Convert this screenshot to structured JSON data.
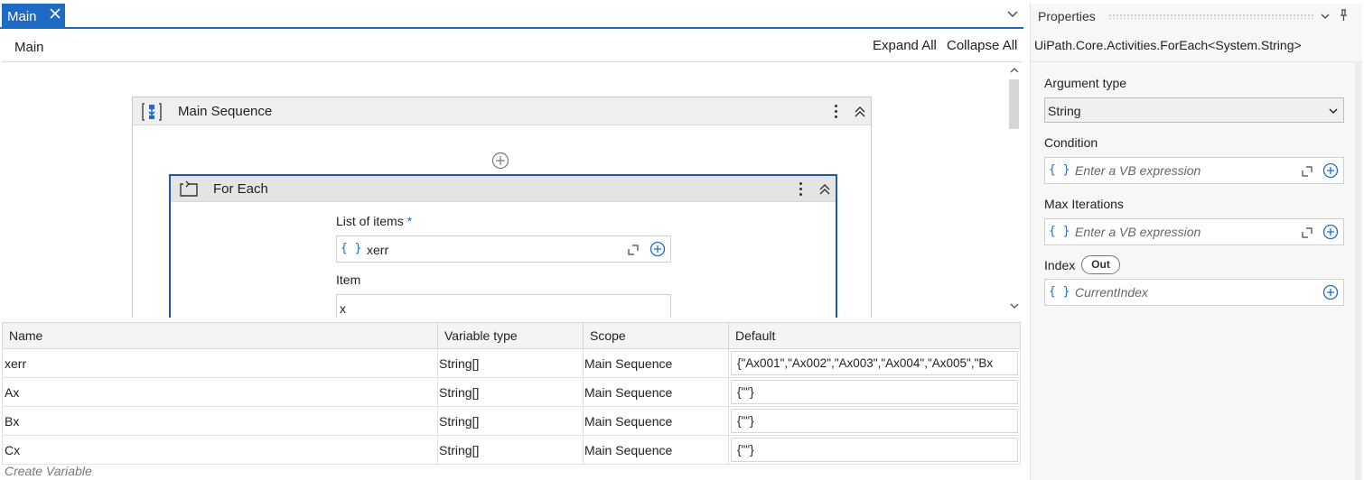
{
  "tabs": [
    {
      "label": "Main",
      "close_icon": "close-icon"
    }
  ],
  "toolbar": {
    "breadcrumb": "Main",
    "expand_all": "Expand All",
    "collapse_all": "Collapse All"
  },
  "workflow": {
    "main_sequence": {
      "title": "Main Sequence"
    },
    "for_each": {
      "title": "For Each",
      "list_of_items_label": "List of items",
      "required_mark": "*",
      "list_of_items_value": "xerr",
      "item_label": "Item",
      "item_value": "x"
    }
  },
  "variables": {
    "headers": [
      "Name",
      "Variable type",
      "Scope",
      "Default"
    ],
    "rows": [
      {
        "name": "xerr",
        "type": "String[]",
        "scope": "Main Sequence",
        "default": "{\"Ax001\",\"Ax002\",\"Ax003\",\"Ax004\",\"Ax005\",\"Bx"
      },
      {
        "name": "Ax",
        "type": "String[]",
        "scope": "Main Sequence",
        "default": "{\"\"}"
      },
      {
        "name": "Bx",
        "type": "String[]",
        "scope": "Main Sequence",
        "default": "{\"\"}"
      },
      {
        "name": "Cx",
        "type": "String[]",
        "scope": "Main Sequence",
        "default": "{\"\"}"
      }
    ],
    "create_placeholder": "Create Variable"
  },
  "properties": {
    "title": "Properties",
    "activity_class": "UiPath.Core.Activities.ForEach<System.String>",
    "argument_type_label": "Argument type",
    "argument_type_value": "String",
    "condition_label": "Condition",
    "condition_placeholder": "Enter a VB expression",
    "max_iterations_label": "Max Iterations",
    "max_iterations_placeholder": "Enter a VB expression",
    "index_label": "Index",
    "index_badge": "Out",
    "index_placeholder": "CurrentIndex"
  },
  "icons": {
    "curly": "{ }"
  },
  "colors": {
    "accent": "#1e6ac4",
    "selection_border": "#1e5aa8"
  }
}
